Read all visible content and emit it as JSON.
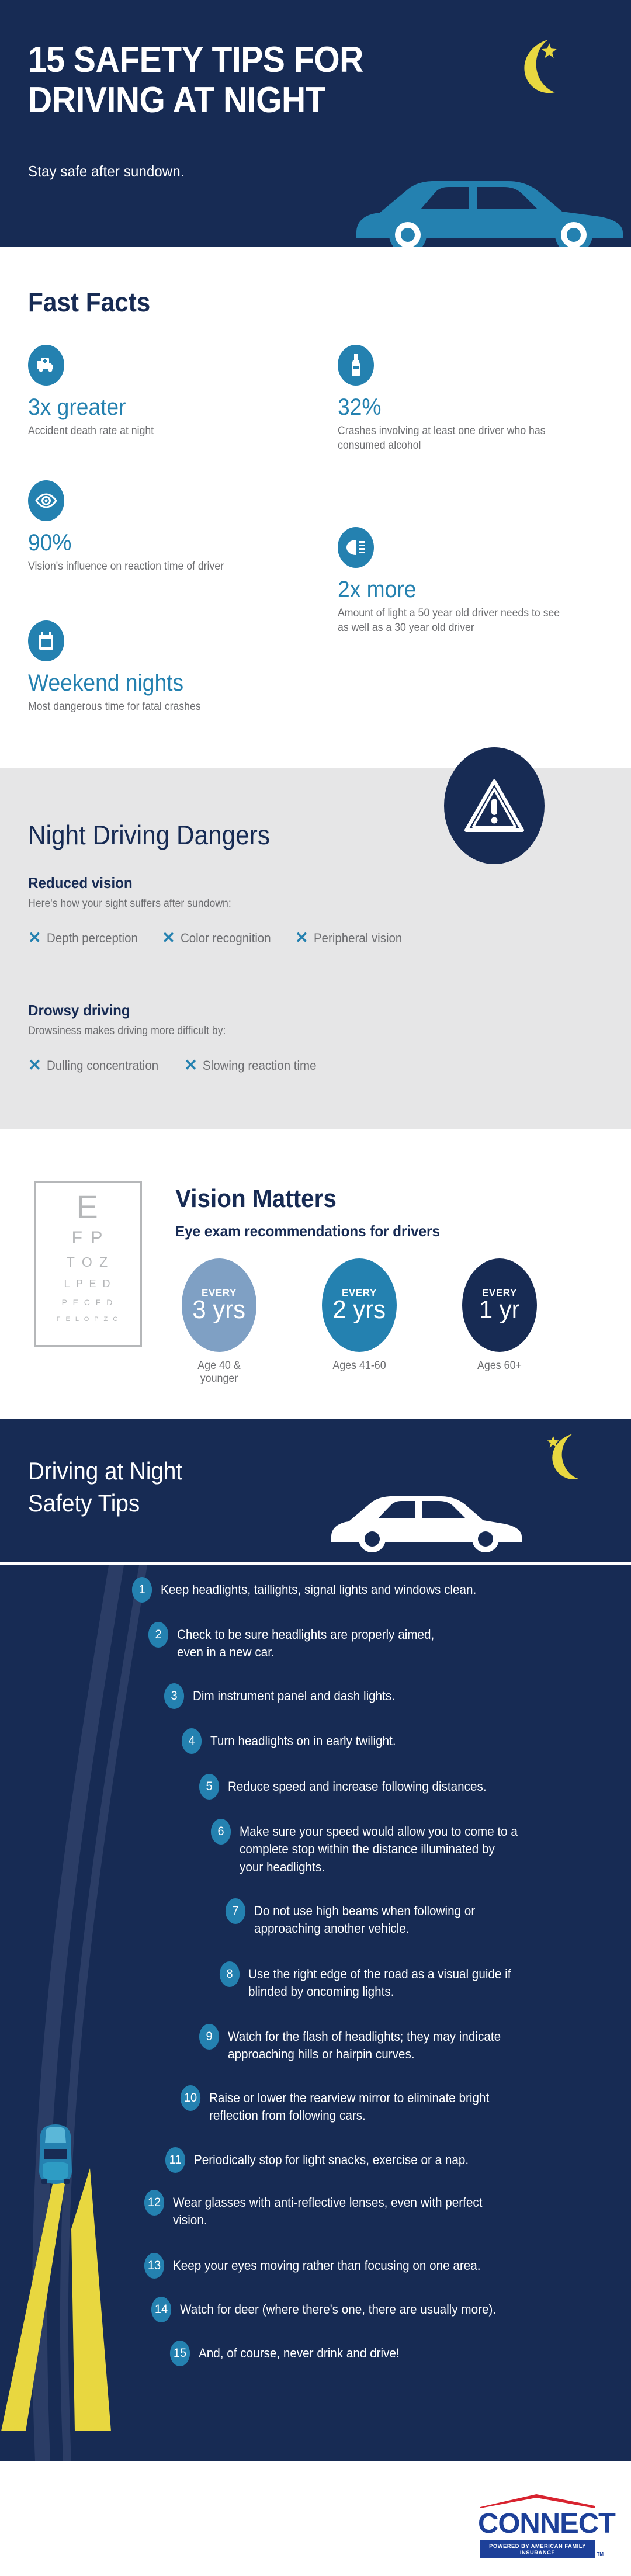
{
  "hero": {
    "title_line1": "15 SAFETY TIPS FOR",
    "title_line2": "DRIVING AT NIGHT",
    "subtitle": "Stay safe after sundown."
  },
  "fast_facts": {
    "heading": "Fast Facts",
    "items": [
      {
        "icon": "ambulance-icon",
        "stat": "3x greater",
        "desc": "Accident death rate at night"
      },
      {
        "icon": "bottle-icon",
        "stat": "32%",
        "desc": "Crashes involving at least one driver who has consumed alcohol"
      },
      {
        "icon": "eye-icon",
        "stat": "90%",
        "desc": "Vision's influence on reaction time of driver"
      },
      {
        "icon": "headlight-icon",
        "stat": "2x more",
        "desc": "Amount of light a 50 year old driver needs to see as well as a 30 year old driver"
      },
      {
        "icon": "calendar-icon",
        "stat": "Weekend nights",
        "desc": "Most dangerous time for fatal crashes"
      }
    ]
  },
  "dangers": {
    "heading": "Night Driving Dangers",
    "groups": [
      {
        "title": "Reduced vision",
        "desc": "Here's how your sight suffers after sundown:",
        "items": [
          "Depth perception",
          "Color recognition",
          "Peripheral vision"
        ]
      },
      {
        "title": "Drowsy driving",
        "desc": "Drowsiness makes driving more difficult by:",
        "items": [
          "Dulling concentration",
          "Slowing reaction time"
        ]
      }
    ]
  },
  "vision": {
    "heading": "Vision Matters",
    "subheading": "Eye exam recommendations for drivers",
    "eye_chart_rows": [
      "E",
      "F P",
      "T O Z",
      "L P E D",
      "P E C F D",
      "F E L O P Z C"
    ],
    "recommendations": [
      {
        "every_label": "EVERY",
        "interval": "3 yrs",
        "caption": "Age 40 & younger",
        "color": "#7fa0c4"
      },
      {
        "every_label": "EVERY",
        "interval": "2 yrs",
        "caption": "Ages 41-60",
        "color": "#2481b0"
      },
      {
        "every_label": "EVERY",
        "interval": "1 yr",
        "caption": "Ages 60+",
        "color": "#172b54"
      }
    ]
  },
  "tips_section": {
    "title_line1": "Driving at Night",
    "title_line2": "Safety Tips",
    "tips": [
      {
        "num": "1",
        "text": "Keep headlights, taillights, signal lights and windows clean."
      },
      {
        "num": "2",
        "text": "Check to be sure headlights are properly aimed, even in a new car."
      },
      {
        "num": "3",
        "text": "Dim instrument panel and dash lights."
      },
      {
        "num": "4",
        "text": "Turn headlights on in early twilight."
      },
      {
        "num": "5",
        "text": "Reduce speed and increase following distances."
      },
      {
        "num": "6",
        "text": "Make sure your speed would allow you to come to a complete stop within the distance illuminated by your headlights."
      },
      {
        "num": "7",
        "text": "Do not use high beams when following or approaching another vehicle."
      },
      {
        "num": "8",
        "text": "Use the right edge of the road as a visual guide if blinded by oncoming lights."
      },
      {
        "num": "9",
        "text": "Watch for the flash of headlights; they may indicate approaching hills or hairpin curves."
      },
      {
        "num": "10",
        "text": "Raise or lower the rearview mirror to eliminate bright reflection from following cars."
      },
      {
        "num": "11",
        "text": "Periodically stop for light snacks, exercise or a nap."
      },
      {
        "num": "12",
        "text": "Wear glasses with anti-reflective lenses, even with perfect vision."
      },
      {
        "num": "13",
        "text": "Keep your eyes moving rather than focusing on one area."
      },
      {
        "num": "14",
        "text": "Watch for deer (where there's one, there are usually more)."
      },
      {
        "num": "15",
        "text": "And, of course, never drink and drive!"
      }
    ]
  },
  "footer": {
    "logo_word": "CONNECT",
    "logo_tagline": "POWERED BY AMERICAN FAMILY INSURANCE",
    "trademark": "TM"
  },
  "colors": {
    "navy": "#172b54",
    "blue": "#2481b0",
    "light_blue": "#7fa0c4",
    "gray_bg": "#e6e6e7",
    "body_text": "#6d6e71",
    "yellow": "#e8d740",
    "logo_blue": "#1d4099",
    "logo_red": "#d8232f"
  }
}
